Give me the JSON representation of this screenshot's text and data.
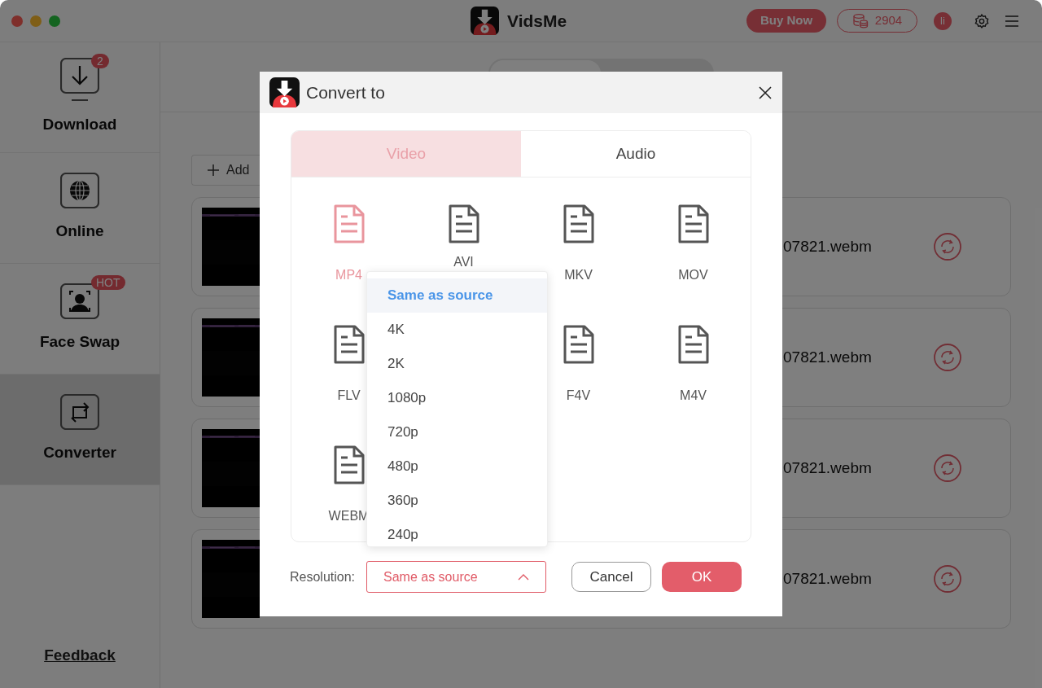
{
  "app": {
    "title": "VidsMe",
    "buy_button": "Buy Now",
    "coins": "2904",
    "avatar": "li"
  },
  "sidebar": {
    "items": [
      {
        "label": "Download",
        "kind": "download",
        "badge": "2",
        "selected": false
      },
      {
        "label": "Online",
        "kind": "globe",
        "selected": false
      },
      {
        "label": "Face Swap",
        "kind": "face",
        "badge": "HOT",
        "selected": false
      },
      {
        "label": "Converter",
        "kind": "convert",
        "selected": true
      }
    ],
    "feedback": "Feedback"
  },
  "main": {
    "add_button": "Add",
    "rows": [
      {
        "filename": "07821.webm"
      },
      {
        "filename": "07821.webm"
      },
      {
        "filename": "07821.webm"
      },
      {
        "filename": "07821.webm"
      }
    ]
  },
  "dialog": {
    "title": "Convert to",
    "tabs": [
      {
        "label": "Video",
        "selected": true
      },
      {
        "label": "Audio",
        "selected": false
      }
    ],
    "formats": [
      {
        "label": "MP4",
        "selected": true
      },
      {
        "label": "AVI",
        "selected": false
      },
      {
        "label": "MKV",
        "selected": false
      },
      {
        "label": "MOV",
        "selected": false
      },
      {
        "label": "FLV",
        "selected": false
      },
      {
        "label": "F4V",
        "selected": false
      },
      {
        "label": "M4V",
        "selected": false
      },
      {
        "label": "WEBM",
        "selected": false
      }
    ],
    "resolution": {
      "label": "Resolution:",
      "value": "Same as source",
      "expanded": true,
      "options": [
        {
          "label": "Same as source",
          "selected": true
        },
        {
          "label": "4K",
          "selected": false
        },
        {
          "label": "2K",
          "selected": false
        },
        {
          "label": "1080p",
          "selected": false
        },
        {
          "label": "720p",
          "selected": false
        },
        {
          "label": "480p",
          "selected": false
        },
        {
          "label": "360p",
          "selected": false
        },
        {
          "label": "240p",
          "selected": false
        }
      ]
    },
    "cancel_button": "Cancel",
    "ok_button": "OK"
  }
}
